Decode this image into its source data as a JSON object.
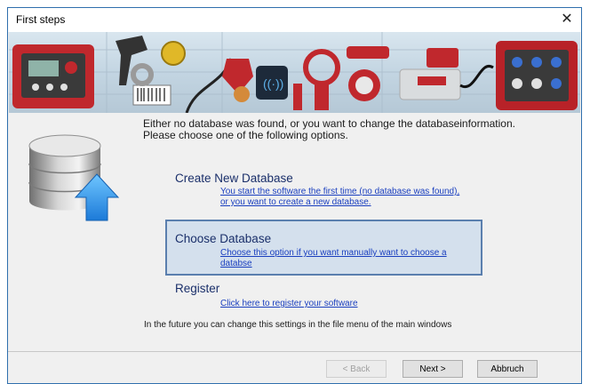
{
  "window": {
    "title": "First steps",
    "close_glyph": "✕"
  },
  "intro": "Either no database was found, or you want to change the databaseinformation. Please choose one of the following options.",
  "options": [
    {
      "title": "Create New Database",
      "link_line1": "You start the software the first time (no database was found),",
      "link_line2": "or you want to create a new database."
    },
    {
      "title": "Choose Database",
      "link_line1": "Choose this option if you want manually want to choose a",
      "link_line2": "databse",
      "selected": true
    },
    {
      "title": "Register",
      "link_line1": "Click here to register your software",
      "link_line2": ""
    }
  ],
  "footer_note": "In the future you can change this settings in the file menu of the main windows",
  "buttons": {
    "back": "< Back",
    "next": "Next >",
    "cancel": "Abbruch"
  },
  "colors": {
    "accent": "#5a7fae",
    "link": "#1a3fbf",
    "title_text": "#1a2f6a"
  },
  "icons": {
    "banner": "measurement-devices-banner",
    "database": "database-upload-icon"
  }
}
